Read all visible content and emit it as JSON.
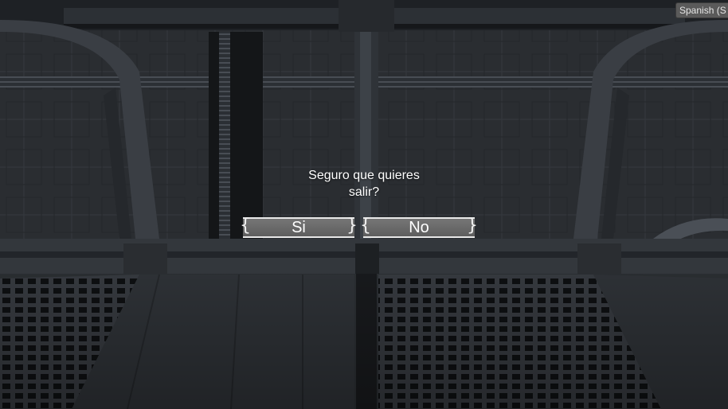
{
  "language_selector": {
    "label": "Spanish (S"
  },
  "dialog": {
    "question": "Seguro que quieres salir?",
    "yes_label": "Si",
    "no_label": "No"
  },
  "colors": {
    "button_fill": "#666666",
    "button_border": "#e8e8e8",
    "text": "#ffffff"
  }
}
